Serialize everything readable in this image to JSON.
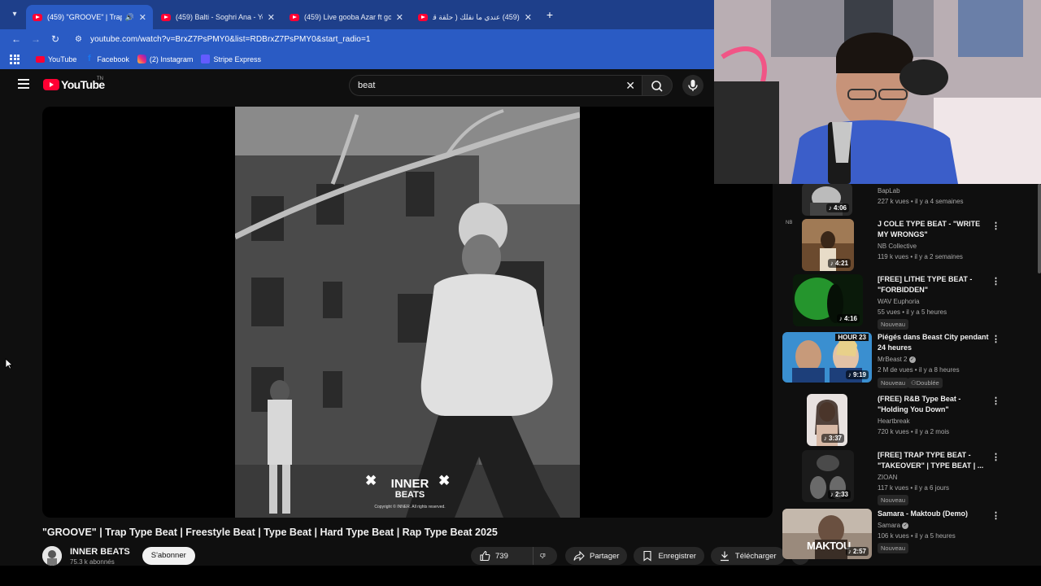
{
  "browser": {
    "tabs": [
      {
        "title": "(459) \"GROOVE\" | Trap Type",
        "active": true,
        "audio": true
      },
      {
        "title": "(459) Balti - Soghri Ana - YouTu",
        "active": false
      },
      {
        "title": "(459) Live gooba Azar ft gomm",
        "active": false
      },
      {
        "title": "(459) عندي ما نقلك ( حلقة قديمة",
        "active": false
      }
    ],
    "url": "youtube.com/watch?v=BrxZ7PsPMY0&list=RDBrxZ7PsPMY0&start_radio=1",
    "bookmarks": [
      {
        "label": "YouTube",
        "icon": "youtube-icon"
      },
      {
        "label": "Facebook",
        "icon": "facebook-icon"
      },
      {
        "label": "(2) Instagram",
        "icon": "instagram-icon"
      },
      {
        "label": "Stripe Express",
        "icon": "stripe-icon"
      }
    ]
  },
  "masthead": {
    "logo_text": "YouTube",
    "region": "TN",
    "search_value": "beat"
  },
  "video": {
    "title": "\"GROOVE\" | Trap Type Beat | Freestyle Beat | Type Beat | Hard Type Beat | Rap Type Beat 2025",
    "watermark_line1": "INNER",
    "watermark_line2": "BEATS",
    "copyright": "Copyright © INNER. All rights reserved.",
    "channel": "INNER BEATS",
    "subscribers": "75.3 k abonnés",
    "subscribe_label": "S'abonner",
    "likes": "739",
    "share_label": "Partager",
    "save_label": "Enregistrer",
    "download_label": "Télécharger"
  },
  "recommendations": [
    {
      "title": "",
      "channel": "BapLab",
      "meta": "227 k vues • il y a 4 semaines",
      "duration": "4:06"
    },
    {
      "title": "J COLE TYPE BEAT - \"WRITE MY WRONGS\"",
      "channel": "NB Collective",
      "meta": "119 k vues • il y a 2 semaines",
      "duration": "4:21"
    },
    {
      "title": "[FREE] LITHE TYPE BEAT - \"FORBIDDEN\"",
      "channel": "WAV Euphoria",
      "meta": "55 vues • il y a 5 heures",
      "duration": "4:16",
      "badge": "Nouveau"
    },
    {
      "title": "Piégés dans Beast City pendant 24 heures",
      "channel": "MrBeast 2",
      "meta": "2 M de vues • il y a 8 heures",
      "duration": "9:19",
      "badge": "Nouveau",
      "badge2": "Doublée",
      "thumb_text": "HOUR 23"
    },
    {
      "title": "(FREE) R&B Type Beat - \"Holding You Down\"",
      "channel": "Heartbreak",
      "meta": "720 k vues • il y a 2 mois",
      "duration": "3:37"
    },
    {
      "title": "[FREE] TRAP TYPE BEAT - \"TAKEOVER\" | TYPE BEAT | ...",
      "channel": "ZIOAN",
      "meta": "117 k vues • il y a 6 jours",
      "duration": "2:33",
      "badge": "Nouveau"
    },
    {
      "title": "Samara - Maktoub (Demo)",
      "channel": "Samara",
      "meta": "106 k vues • il y a 5 heures",
      "duration": "2:57",
      "badge": "Nouveau",
      "thumb_text": "MAKTOU"
    }
  ],
  "colors": {
    "chrome_tabbar": "#1e3f8a",
    "chrome_toolbar": "#2a5bc4",
    "yt_bg": "#0f0f0f",
    "yt_red": "#ff0033"
  }
}
